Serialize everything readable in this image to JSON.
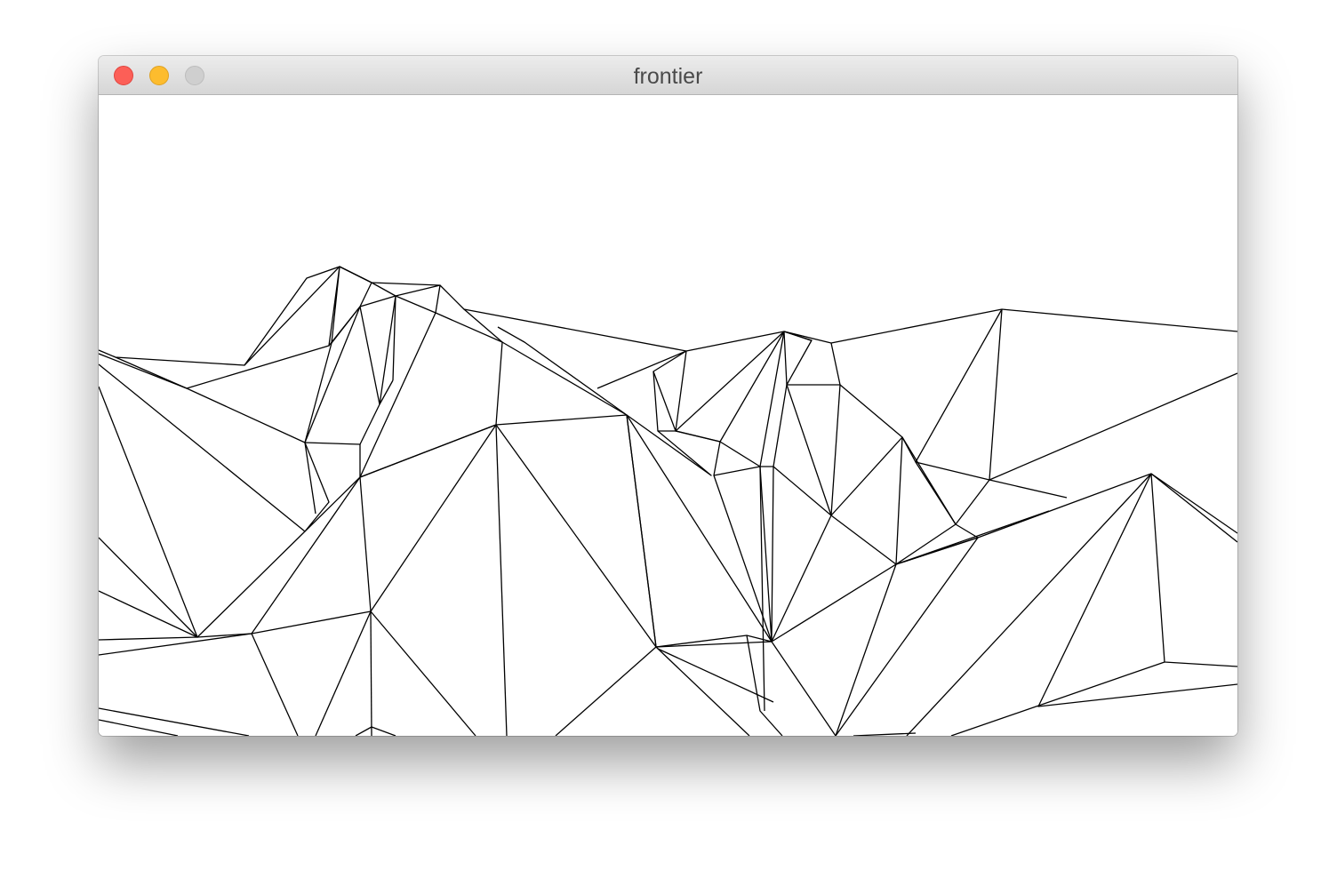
{
  "window": {
    "title": "frontier"
  },
  "colors": {
    "titlebar": "#e3e3e3",
    "close": "#fc5f57",
    "minimize": "#fdbc2e",
    "zoom": "#cfcfcf",
    "canvas_background": "#ffffff",
    "mesh_stroke": "#000000"
  },
  "icons": {
    "close": "close-icon",
    "minimize": "minimize-icon",
    "zoom": "zoom-icon"
  }
}
